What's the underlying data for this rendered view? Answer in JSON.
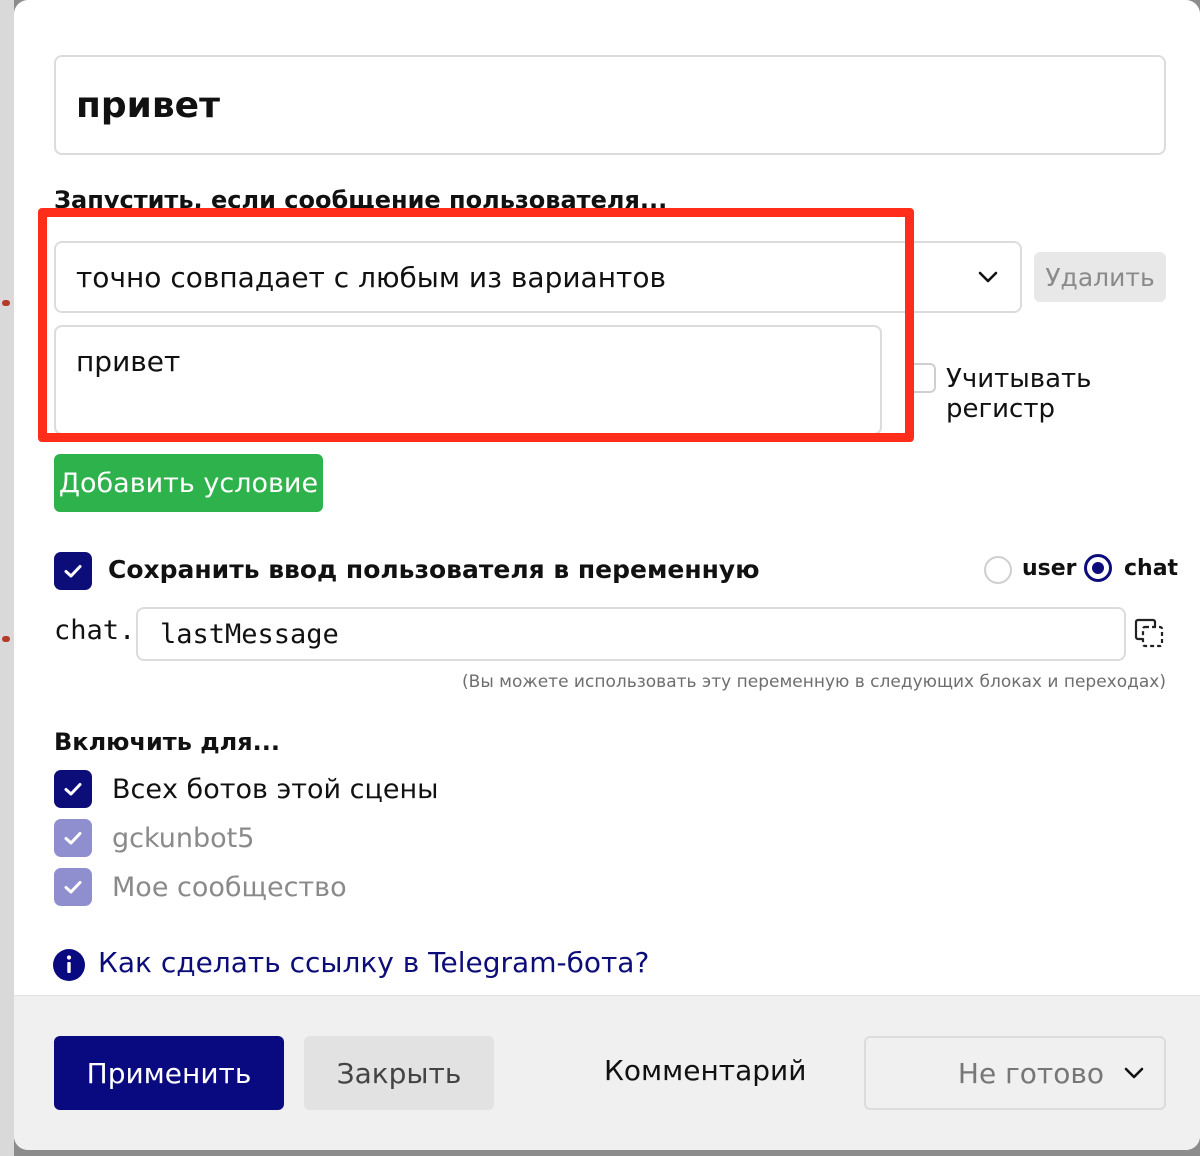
{
  "block": {
    "name": "привет"
  },
  "trigger": {
    "label": "Запустить, если сообщение пользователя...",
    "condition": "точно совпадает с любым из вариантов",
    "delete_label": "Удалить",
    "variants": "привет",
    "case_sensitive_label": "Учитывать регистр",
    "add_condition_label": "Добавить условие"
  },
  "save_input": {
    "label": "Сохранить ввод пользователя в переменную",
    "scope_user": "user",
    "scope_chat": "chat",
    "selected_scope": "chat",
    "prefix": "chat.",
    "variable": "lastMessage",
    "hint": "(Вы можете использовать эту переменную в следующих блоках и переходах)"
  },
  "include": {
    "label": "Включить для...",
    "items": [
      {
        "label": "Всех ботов этой сцены",
        "checked": true
      },
      {
        "label": "gckunbot5",
        "checked": true
      },
      {
        "label": "Мое сообщество",
        "checked": true
      }
    ]
  },
  "help": {
    "link": "Как сделать ссылку в Telegram-бота?"
  },
  "footer": {
    "apply": "Применить",
    "close": "Закрыть",
    "comment": "Комментарий",
    "status": "Не готово"
  },
  "colors": {
    "accent": "#0a0a80",
    "success": "#2eb24b",
    "highlight": "#ff2d1a"
  }
}
